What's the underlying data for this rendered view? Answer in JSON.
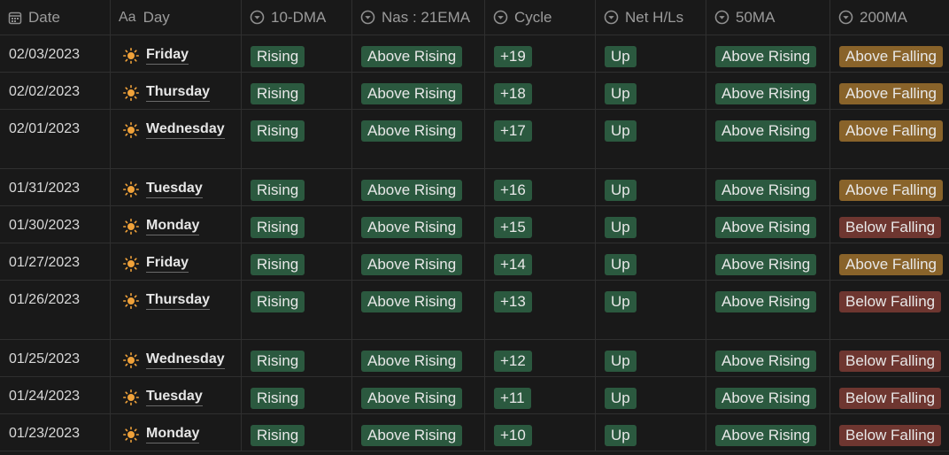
{
  "headers": {
    "date": "Date",
    "day_prefix": "Aa",
    "day": "Day",
    "dma10": "10-DMA",
    "ema21": "Nas : 21EMA",
    "cycle": "Cycle",
    "net": "Net H/Ls",
    "ma50": "50MA",
    "ma200": "200MA"
  },
  "colors": {
    "green": "#2b593f",
    "orange": "#89632a",
    "red": "#6e3630",
    "sun": "#f0a23a",
    "background": "#191919"
  },
  "icons": {
    "date": "calendar-icon",
    "day": "text-aa-icon",
    "select": "chevron-circle-icon",
    "day_cell": "sun-icon"
  },
  "rows": [
    {
      "date": "02/03/2023",
      "day": "Friday",
      "dma10": "Rising",
      "ema21": "Above Rising",
      "cycle": "+19",
      "net": "Up",
      "ma50": "Above Rising",
      "ma200": "Above Falling",
      "ma200_color": "orange",
      "tall": false
    },
    {
      "date": "02/02/2023",
      "day": "Thursday",
      "dma10": "Rising",
      "ema21": "Above Rising",
      "cycle": "+18",
      "net": "Up",
      "ma50": "Above Rising",
      "ma200": "Above Falling",
      "ma200_color": "orange",
      "tall": false
    },
    {
      "date": "02/01/2023",
      "day": "Wednesday",
      "dma10": "Rising",
      "ema21": "Above Rising",
      "cycle": "+17",
      "net": "Up",
      "ma50": "Above Rising",
      "ma200": "Above Falling",
      "ma200_color": "orange",
      "tall": true
    },
    {
      "date": "01/31/2023",
      "day": "Tuesday",
      "dma10": "Rising",
      "ema21": "Above Rising",
      "cycle": "+16",
      "net": "Up",
      "ma50": "Above Rising",
      "ma200": "Above Falling",
      "ma200_color": "orange",
      "tall": false
    },
    {
      "date": "01/30/2023",
      "day": "Monday",
      "dma10": "Rising",
      "ema21": "Above Rising",
      "cycle": "+15",
      "net": "Up",
      "ma50": "Above Rising",
      "ma200": "Below Falling",
      "ma200_color": "red",
      "tall": false
    },
    {
      "date": "01/27/2023",
      "day": "Friday",
      "dma10": "Rising",
      "ema21": "Above Rising",
      "cycle": "+14",
      "net": "Up",
      "ma50": "Above Rising",
      "ma200": "Above Falling",
      "ma200_color": "orange",
      "tall": false
    },
    {
      "date": "01/26/2023",
      "day": "Thursday",
      "dma10": "Rising",
      "ema21": "Above Rising",
      "cycle": "+13",
      "net": "Up",
      "ma50": "Above Rising",
      "ma200": "Below Falling",
      "ma200_color": "red",
      "tall": true
    },
    {
      "date": "01/25/2023",
      "day": "Wednesday",
      "dma10": "Rising",
      "ema21": "Above Rising",
      "cycle": "+12",
      "net": "Up",
      "ma50": "Above Rising",
      "ma200": "Below Falling",
      "ma200_color": "red",
      "tall": false
    },
    {
      "date": "01/24/2023",
      "day": "Tuesday",
      "dma10": "Rising",
      "ema21": "Above Rising",
      "cycle": "+11",
      "net": "Up",
      "ma50": "Above Rising",
      "ma200": "Below Falling",
      "ma200_color": "red",
      "tall": false
    },
    {
      "date": "01/23/2023",
      "day": "Monday",
      "dma10": "Rising",
      "ema21": "Above Rising",
      "cycle": "+10",
      "net": "Up",
      "ma50": "Above Rising",
      "ma200": "Below Falling",
      "ma200_color": "red",
      "tall": false
    }
  ]
}
